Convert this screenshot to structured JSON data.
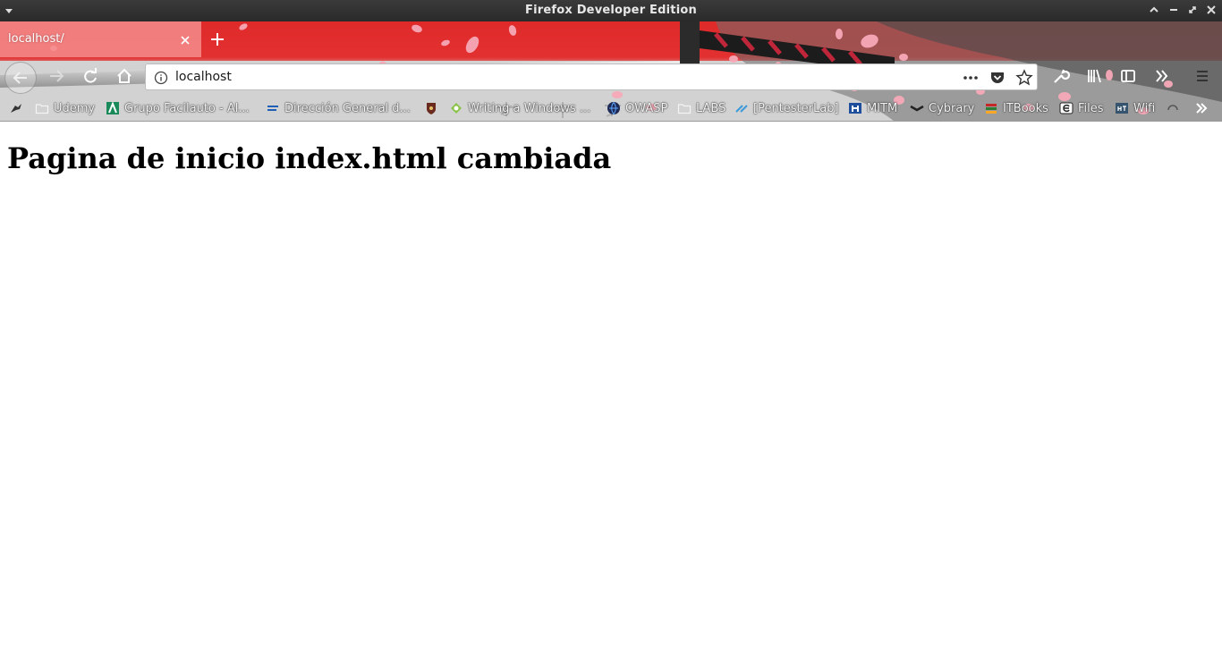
{
  "window": {
    "title": "Firefox Developer Edition"
  },
  "tab": {
    "title": "localhost/"
  },
  "urlbar": {
    "value": "localhost"
  },
  "bookmarks": [
    {
      "label": "",
      "icon": "bird-icon"
    },
    {
      "label": "Udemy",
      "icon": "folder-icon"
    },
    {
      "label": "Grupo Facilauto - Al...",
      "icon": "facilauto-icon"
    },
    {
      "label": "Dirección General d...",
      "icon": "dgt-icon"
    },
    {
      "label": "",
      "icon": "crest-icon"
    },
    {
      "label": "Writing a Windows ...",
      "icon": "android-icon"
    },
    {
      "label": "OWASP",
      "icon": "globe-icon"
    },
    {
      "label": "LABS",
      "icon": "folder-icon"
    },
    {
      "label": "[PentesterLab]",
      "icon": "pentesterlab-icon"
    },
    {
      "label": "MITM",
      "icon": "mitm-icon"
    },
    {
      "label": "Cybrary",
      "icon": "cybrary-icon"
    },
    {
      "label": "ITBooks",
      "icon": "books-icon"
    },
    {
      "label": "Files",
      "icon": "files-icon"
    },
    {
      "label": "Wifi",
      "icon": "ht-icon"
    }
  ],
  "page": {
    "heading": "Pagina de inicio index.html cambiada"
  },
  "colors": {
    "theme_red": "#e02a2a",
    "tab_selected": "#f58c8c",
    "titlebar": "#2f2f2f"
  }
}
